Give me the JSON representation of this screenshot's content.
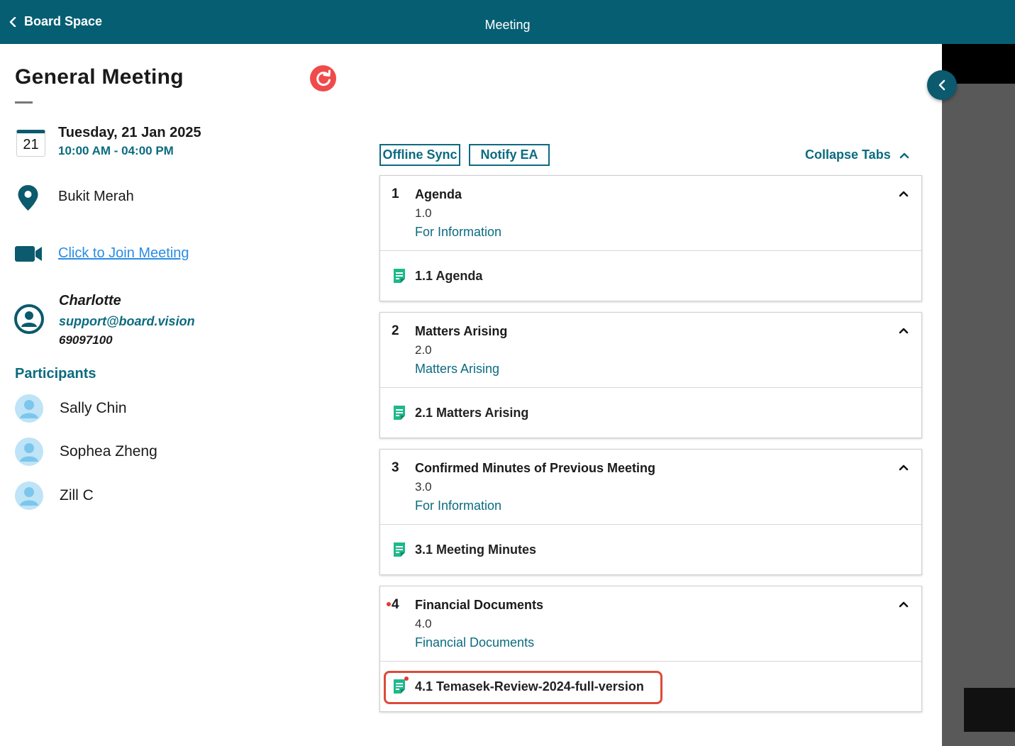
{
  "header": {
    "back_label": "Board Space",
    "title": "Meeting"
  },
  "meeting": {
    "title": "General Meeting",
    "calendar_day": "21",
    "date": "Tuesday, 21 Jan 2025",
    "time": "10:00 AM - 04:00 PM",
    "location": "Bukit Merah",
    "join_link": "Click to Join Meeting",
    "contact": {
      "name": "Charlotte",
      "email": "support@board.vision",
      "phone": "69097100"
    }
  },
  "participants": {
    "heading": "Participants",
    "items": [
      {
        "name": "Sally Chin"
      },
      {
        "name": "Sophea Zheng"
      },
      {
        "name": "Zill C"
      }
    ]
  },
  "actions": {
    "offline_sync": "Offline Sync",
    "notify_ea": "Notify EA",
    "collapse_tabs": "Collapse Tabs"
  },
  "agenda": [
    {
      "number": "1",
      "title": "Agenda",
      "version": "1.0",
      "subtitle": "For Information",
      "item": "1.1 Agenda",
      "unread": false
    },
    {
      "number": "2",
      "title": "Matters Arising",
      "version": "2.0",
      "subtitle": "Matters Arising",
      "item": "2.1 Matters Arising",
      "unread": false
    },
    {
      "number": "3",
      "title": "Confirmed Minutes of Previous Meeting",
      "version": "3.0",
      "subtitle": "For Information",
      "item": "3.1 Meeting Minutes",
      "unread": false
    },
    {
      "number": "4",
      "title": "Financial Documents",
      "version": "4.0",
      "subtitle": "Financial Documents",
      "item": "4.1 Temasek-Review-2024-full-version",
      "unread": true
    }
  ],
  "colors": {
    "header_bg": "#065e73",
    "accent": "#0b6b80",
    "link": "#2a8de2",
    "refresh": "#ef4b4b",
    "doc_icon": "#1db98a",
    "highlight": "#dc4a3a",
    "unread_dot": "#e53935"
  }
}
